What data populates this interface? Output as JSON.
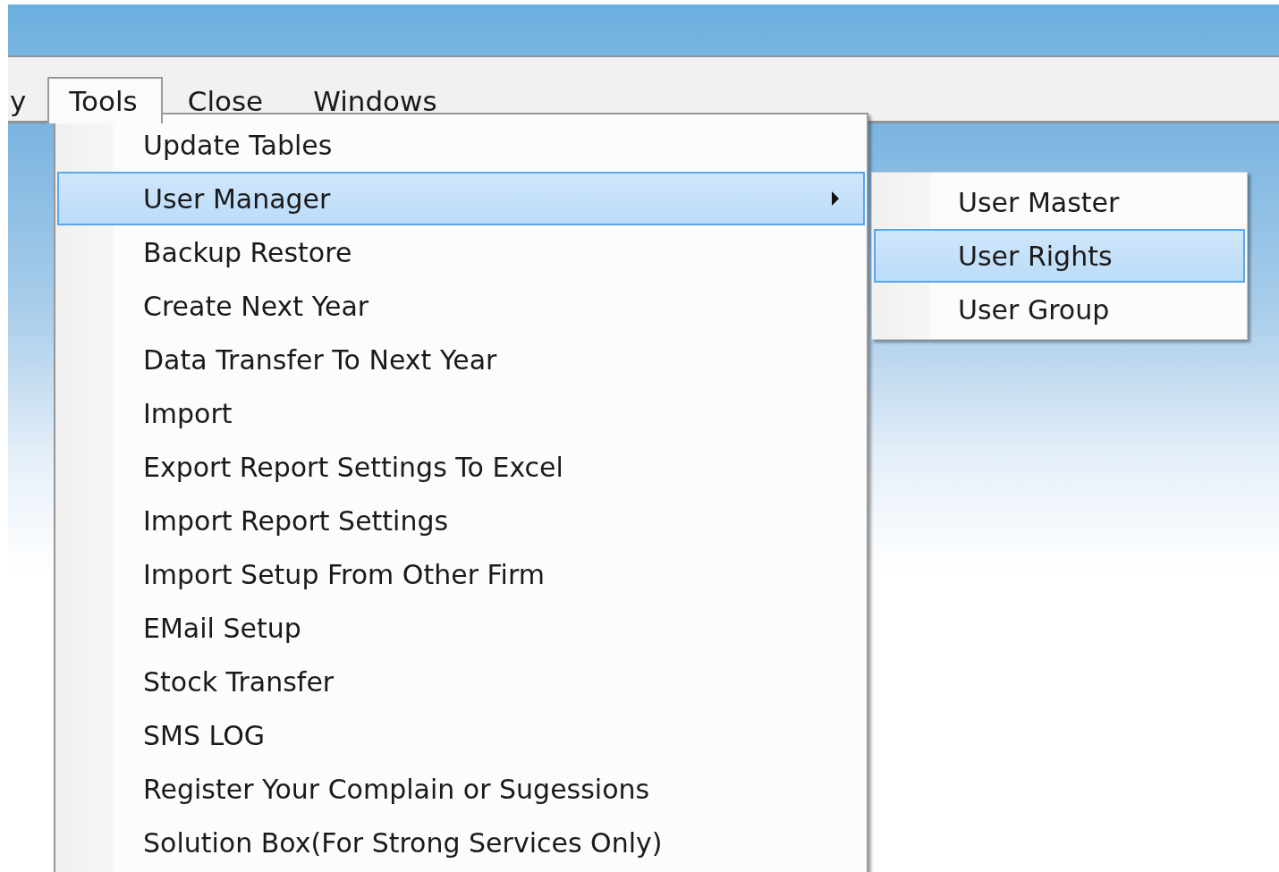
{
  "menubar": {
    "items": [
      {
        "label": "y",
        "selected": false
      },
      {
        "label": "Tools",
        "selected": true
      },
      {
        "label": "Close",
        "selected": false
      },
      {
        "label": "Windows",
        "selected": false
      }
    ]
  },
  "menu": {
    "items": [
      {
        "label": "Update Tables",
        "selected": false,
        "has_submenu": false
      },
      {
        "label": "User Manager",
        "selected": true,
        "has_submenu": true
      },
      {
        "label": "Backup Restore",
        "selected": false,
        "has_submenu": false
      },
      {
        "label": "Create Next Year",
        "selected": false,
        "has_submenu": false
      },
      {
        "label": "Data Transfer To Next Year",
        "selected": false,
        "has_submenu": false
      },
      {
        "label": "Import",
        "selected": false,
        "has_submenu": false
      },
      {
        "label": "Export Report Settings To Excel",
        "selected": false,
        "has_submenu": false
      },
      {
        "label": "Import Report Settings",
        "selected": false,
        "has_submenu": false
      },
      {
        "label": "Import Setup From Other Firm",
        "selected": false,
        "has_submenu": false
      },
      {
        "label": "EMail Setup",
        "selected": false,
        "has_submenu": false
      },
      {
        "label": "Stock Transfer",
        "selected": false,
        "has_submenu": false
      },
      {
        "label": "SMS LOG",
        "selected": false,
        "has_submenu": false
      },
      {
        "label": "Register Your Complain or Sugessions",
        "selected": false,
        "has_submenu": false
      },
      {
        "label": "Solution Box(For Strong Services Only)",
        "selected": false,
        "has_submenu": false
      }
    ]
  },
  "submenu": {
    "items": [
      {
        "label": "User Master",
        "selected": false
      },
      {
        "label": "User Rights",
        "selected": true
      },
      {
        "label": "User Group",
        "selected": false
      }
    ]
  }
}
